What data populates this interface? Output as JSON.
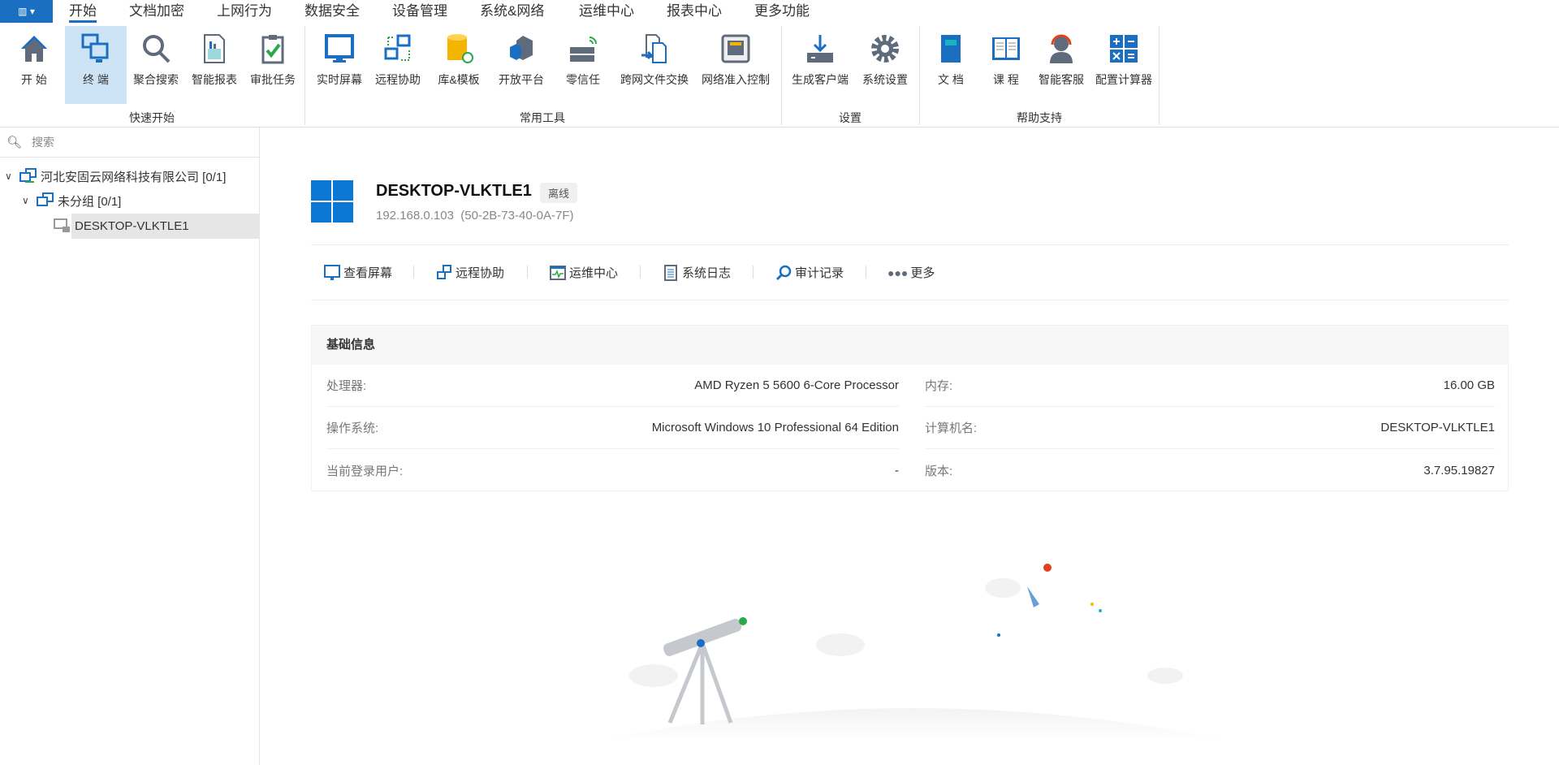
{
  "menu_tabs": [
    "开始",
    "文档加密",
    "上网行为",
    "数据安全",
    "设备管理",
    "系统&网络",
    "运维中心",
    "报表中心",
    "更多功能"
  ],
  "ribbon": {
    "groups": [
      "快速开始",
      "常用工具",
      "设置",
      "帮助支持"
    ],
    "items": [
      "开 始",
      "终 端",
      "聚合搜索",
      "智能报表",
      "审批任务",
      "实时屏幕",
      "远程协助",
      "库&模板",
      "开放平台",
      "零信任",
      "跨网文件交换",
      "网络准入控制",
      "生成客户端",
      "系统设置",
      "文 档",
      "课 程",
      "智能客服",
      "配置计算器"
    ]
  },
  "sidebar": {
    "search_placeholder": "搜索",
    "tree": {
      "root": "河北安固云网络科技有限公司 [0/1]",
      "group": "未分组 [0/1]",
      "device": "DESKTOP-VLKTLE1"
    }
  },
  "device": {
    "name": "DESKTOP-VLKTLE1",
    "status": "离线",
    "ip": "192.168.0.103",
    "mac": "(50-2B-73-40-0A-7F)"
  },
  "actions": [
    "查看屏幕",
    "远程协助",
    "运维中心",
    "系统日志",
    "审计记录",
    "更多"
  ],
  "basic_info": {
    "title": "基础信息",
    "rows": [
      {
        "k": "处理器:",
        "v": "AMD Ryzen 5 5600 6-Core Processor"
      },
      {
        "k": "内存:",
        "v": "16.00 GB"
      },
      {
        "k": "操作系统:",
        "v": "Microsoft Windows 10 Professional 64 Edition"
      },
      {
        "k": "计算机名:",
        "v": "DESKTOP-VLKTLE1"
      },
      {
        "k": "当前登录用户:",
        "v": "-"
      },
      {
        "k": "版本:",
        "v": "3.7.95.19827"
      }
    ]
  },
  "colors": {
    "accent": "#1a6fc2",
    "icon_gray": "#5f6b7a"
  }
}
